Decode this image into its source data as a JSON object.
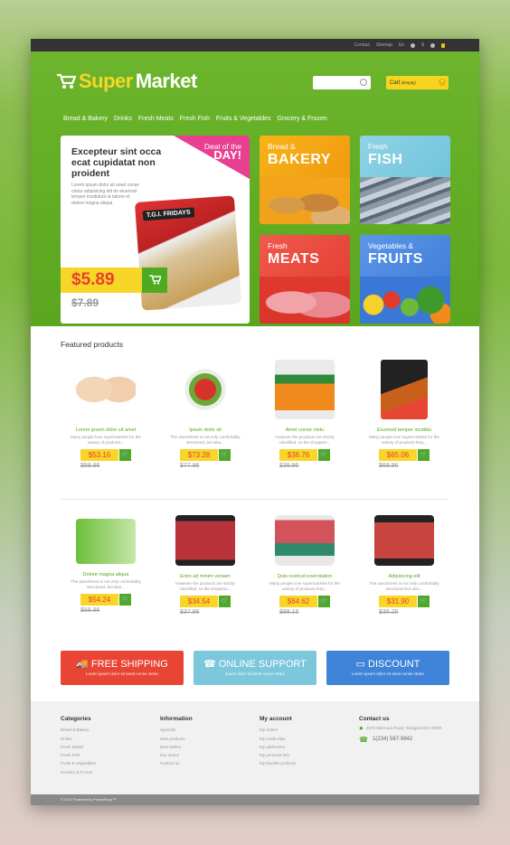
{
  "topbar": {
    "links": [
      "Contact",
      "Sitemap",
      "En",
      "$"
    ]
  },
  "brand": {
    "part1": "Super",
    "part2": "Market"
  },
  "cart": {
    "label": "Cart",
    "status": "(Empty)"
  },
  "nav": [
    "Bread & Bakery",
    "Drinks",
    "Fresh Meats",
    "Fresh Fish",
    "Fruits & Vegetables",
    "Grocery & Frozen"
  ],
  "deal": {
    "title": "Excepteur sint occa ecat cupidatat non proident",
    "text": "Lorem ipsum dolor sit amet conse ctetur adipisicing elit do eiusmod tempor incididunt ut labore et dolore magna aliqua",
    "badge_top": "Deal of the",
    "badge_main": "DAY!",
    "product_label": "T.G.I. FRIDAYS",
    "price": "$5.89",
    "old_price": "$7.89"
  },
  "tiles": [
    {
      "line1": "Bread &",
      "line2": "BAKERY"
    },
    {
      "line1": "Fresh",
      "line2": "FISH"
    },
    {
      "line1": "Fresh",
      "line2": "MEATS"
    },
    {
      "line1": "Vegetables &",
      "line2": "FRUITS"
    }
  ],
  "featured_title": "Featured products",
  "products": [
    {
      "name": "Lorem ipsum dolor sit amet",
      "desc": "Many people love supermarkets for the variety of products...",
      "price": "$53.16",
      "old": "$58.96"
    },
    {
      "name": "Ipsum dolor sit",
      "desc": "The assortment is not only comfortably structured, but also...",
      "price": "$73.28",
      "old": "$77.96"
    },
    {
      "name": "Amet conse ctetu",
      "desc": "However the products are strictly classified, so the shoppers...",
      "price": "$36.76",
      "old": "$39.96"
    },
    {
      "name": "Eiusmod tempor incididu",
      "desc": "Many people love supermarkets for the variety of products they...",
      "price": "$65.06",
      "old": "$69.96"
    },
    {
      "name": "Dolore magna aliqua",
      "desc": "The assortment is not only comfortably structured, but also...",
      "price": "$54.24",
      "old": "$58.96"
    },
    {
      "name": "Enim ad minim veniam",
      "desc": "However the products are strictly classified, so the shoppers...",
      "price": "$34.54",
      "old": "$37.96"
    },
    {
      "name": "Quis nostrud exercitation",
      "desc": "Many people love supermarkets for the variety of products they...",
      "price": "$84.62",
      "old": "$88.15"
    },
    {
      "name": "Adipisicing elit",
      "desc": "The assortment is not only comfortably structured but also...",
      "price": "$31.90",
      "old": "$36.25"
    }
  ],
  "banners": [
    {
      "title": "FREE SHIPPING",
      "sub": "Lorem ipsum dolor sit amet conse ctetur"
    },
    {
      "title": "ONLINE SUPPORT",
      "sub": "Ipsum dolor sit amet conse ctetur"
    },
    {
      "title": "DISCOUNT",
      "sub": "Lorem ipsum dolor sit amet conse ctetur"
    }
  ],
  "footer": {
    "categories": {
      "title": "Categories",
      "items": [
        "Bread & Bakery",
        "Drinks",
        "Fresh Meats",
        "Fresh Fish",
        "Fruits & Vegetables",
        "Grocery & Frozen"
      ]
    },
    "information": {
      "title": "Information",
      "items": [
        "Specials",
        "New products",
        "Best sellers",
        "Our stores",
        "Contact us"
      ]
    },
    "account": {
      "title": "My account",
      "items": [
        "My orders",
        "My credit slips",
        "My addresses",
        "My personal info",
        "My favorite products"
      ]
    },
    "contact": {
      "title": "Contact us",
      "address": "4578 Marmora Road, Glasgow D04 89GR",
      "phone": "1(234) 567-9842"
    }
  },
  "copyright": "© 2017 Powered by PrestaShop™",
  "colors": {
    "green": "#6cb52c",
    "yellow": "#f7d629",
    "pink": "#e83f91",
    "red": "#e84535",
    "lightblue": "#7cc7dc",
    "blue": "#3f84d8"
  }
}
